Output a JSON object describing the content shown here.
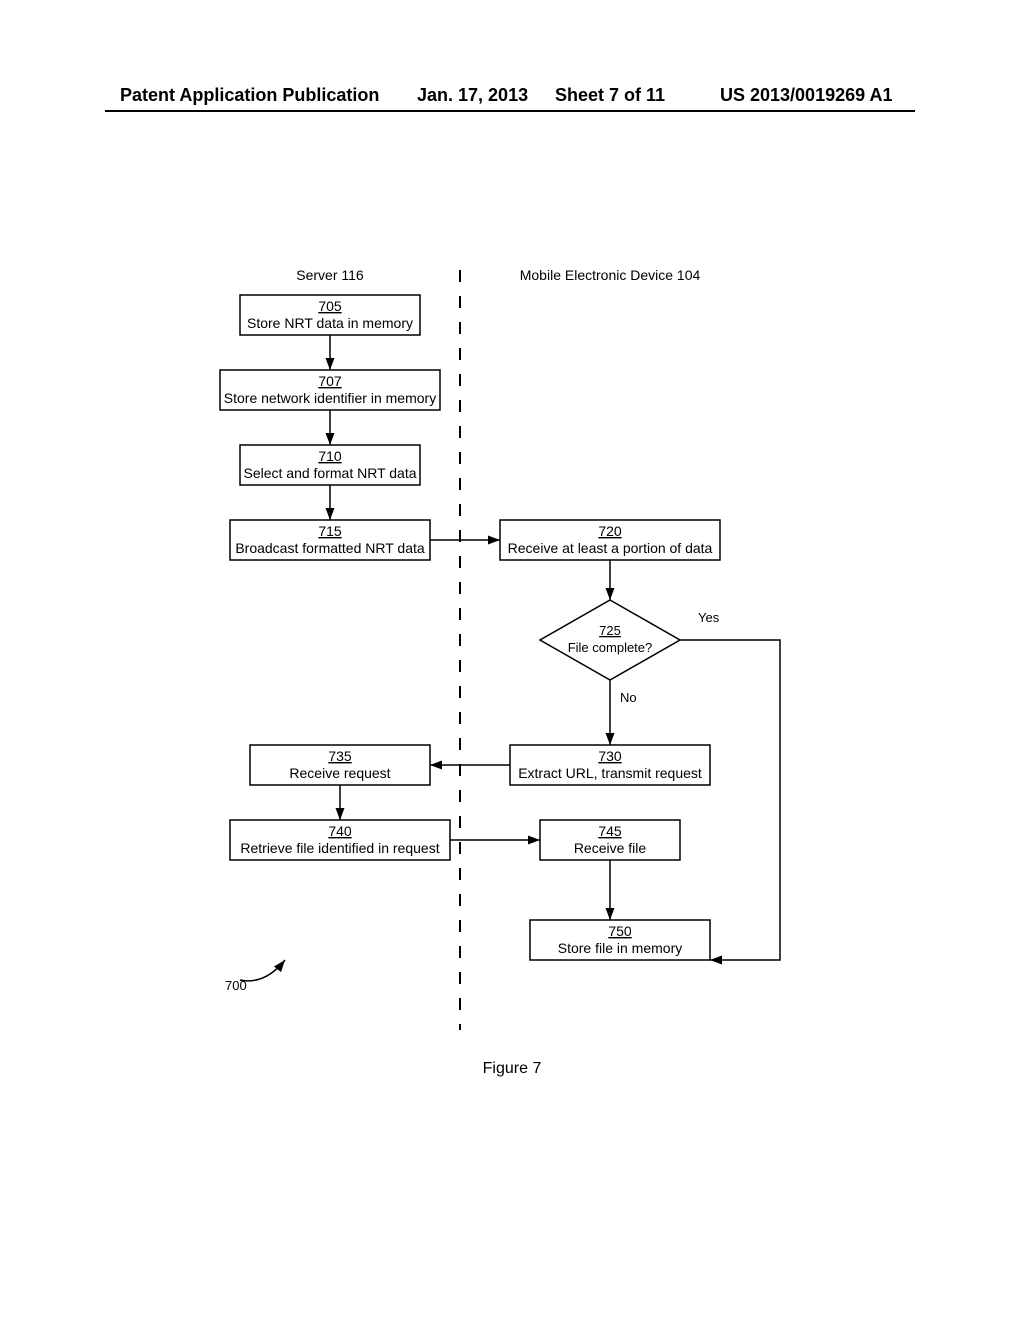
{
  "header": {
    "pub_type": "Patent Application Publication",
    "date": "Jan. 17, 2013",
    "sheet": "Sheet 7 of 11",
    "pub_no": "US 2013/0019269 A1"
  },
  "figure_caption": "Figure 7",
  "swimlanes": {
    "left_title": "Server 116",
    "right_title": "Mobile Electronic Device 104"
  },
  "boxes": {
    "b705": {
      "num": "705",
      "text": "Store NRT data in memory"
    },
    "b707": {
      "num": "707",
      "text": "Store network identifier in memory"
    },
    "b710": {
      "num": "710",
      "text": "Select and format NRT data"
    },
    "b715": {
      "num": "715",
      "text": "Broadcast formatted NRT data"
    },
    "b720": {
      "num": "720",
      "text": "Receive at least a portion of data"
    },
    "b725": {
      "num": "725",
      "text": "File complete?"
    },
    "b730": {
      "num": "730",
      "text": "Extract URL, transmit request"
    },
    "b735": {
      "num": "735",
      "text": "Receive request"
    },
    "b740": {
      "num": "740",
      "text": "Retrieve file identified in request"
    },
    "b745": {
      "num": "745",
      "text": "Receive file"
    },
    "b750": {
      "num": "750",
      "text": "Store file in memory"
    }
  },
  "labels": {
    "yes": "Yes",
    "no": "No",
    "ref700": "700"
  }
}
